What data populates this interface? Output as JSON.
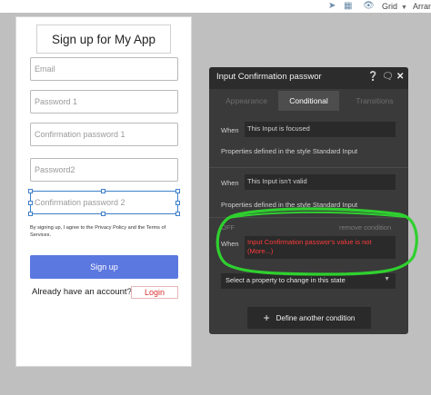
{
  "toolbar": {
    "grid_label": "Grid",
    "arrange_label": "Arrange"
  },
  "page": {
    "title": "Sign up for My App",
    "fields": [
      {
        "placeholder": "Email"
      },
      {
        "placeholder": "Password 1"
      },
      {
        "placeholder": "Confirmation password 1"
      },
      {
        "placeholder": "Password2"
      },
      {
        "placeholder": "Confirmation password 2"
      }
    ],
    "terms": "By signing up, I agree to the Privacy Policy and the Terms of Services.",
    "signup_label": "Sign up",
    "already_text": "Already have an account?",
    "login_label": "Login"
  },
  "panel": {
    "title": "Input Confirmation passwor",
    "tabs": [
      {
        "label": "Appearance"
      },
      {
        "label": "Conditional"
      },
      {
        "label": "Transitions"
      }
    ],
    "conditions": [
      {
        "when_label": "When",
        "expression": "This Input is focused",
        "properties": "Properties defined in the style Standard Input"
      },
      {
        "when_label": "When",
        "expression": "This Input isn't valid",
        "properties": "Properties defined in the style Standard Input"
      },
      {
        "off_label": "OFF",
        "remove_label": "remove condition",
        "when_label": "When",
        "expression": "Input Confirmation passwor's value is not (More...)"
      }
    ],
    "select_property_label": "Select a property to change in this state",
    "define_label": "Define another condition"
  },
  "colors": {
    "accent": "#5b77e0",
    "highlight": "#2fd02f",
    "error": "#ff3b3b"
  }
}
